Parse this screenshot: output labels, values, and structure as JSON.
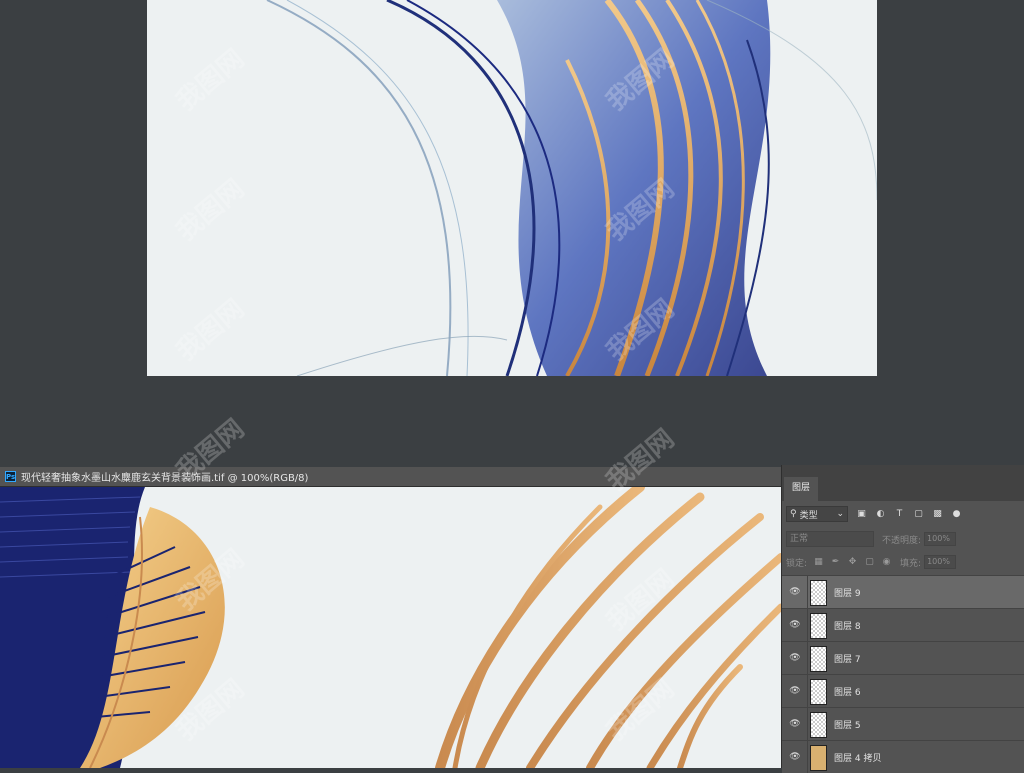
{
  "document": {
    "title": "现代轻奢抽象水墨山水麋鹿玄关背景装饰画.tif @ 100%(RGB/8)",
    "app_icon": "Ps"
  },
  "layers_panel": {
    "tab_label": "图层",
    "filter": {
      "label": "类型",
      "icons": [
        "image-filter-icon",
        "adjustment-filter-icon",
        "type-filter-icon",
        "shape-filter-icon",
        "smart-object-filter-icon",
        "filter-toggle-icon"
      ]
    },
    "blend_mode": "正常",
    "opacity_label": "不透明度:",
    "opacity_value": "100%",
    "lock_label": "锁定:",
    "fill_label": "填充:",
    "fill_value": "100%",
    "layers": [
      {
        "name": "图层 9",
        "selected": true,
        "thumb": "transparent"
      },
      {
        "name": "图层 8",
        "selected": false,
        "thumb": "transparent"
      },
      {
        "name": "图层 7",
        "selected": false,
        "thumb": "transparent"
      },
      {
        "name": "图层 6",
        "selected": false,
        "thumb": "transparent"
      },
      {
        "name": "图层 5",
        "selected": false,
        "thumb": "transparent"
      },
      {
        "name": "图层 4 拷贝",
        "selected": false,
        "thumb": "art"
      }
    ]
  },
  "watermark": "我图网",
  "colors": {
    "navy": "#1a2470",
    "gold": "#e8b868",
    "copper": "#d49a5c",
    "canvas": "#edf1f2",
    "workspace": "#3b3f42"
  }
}
